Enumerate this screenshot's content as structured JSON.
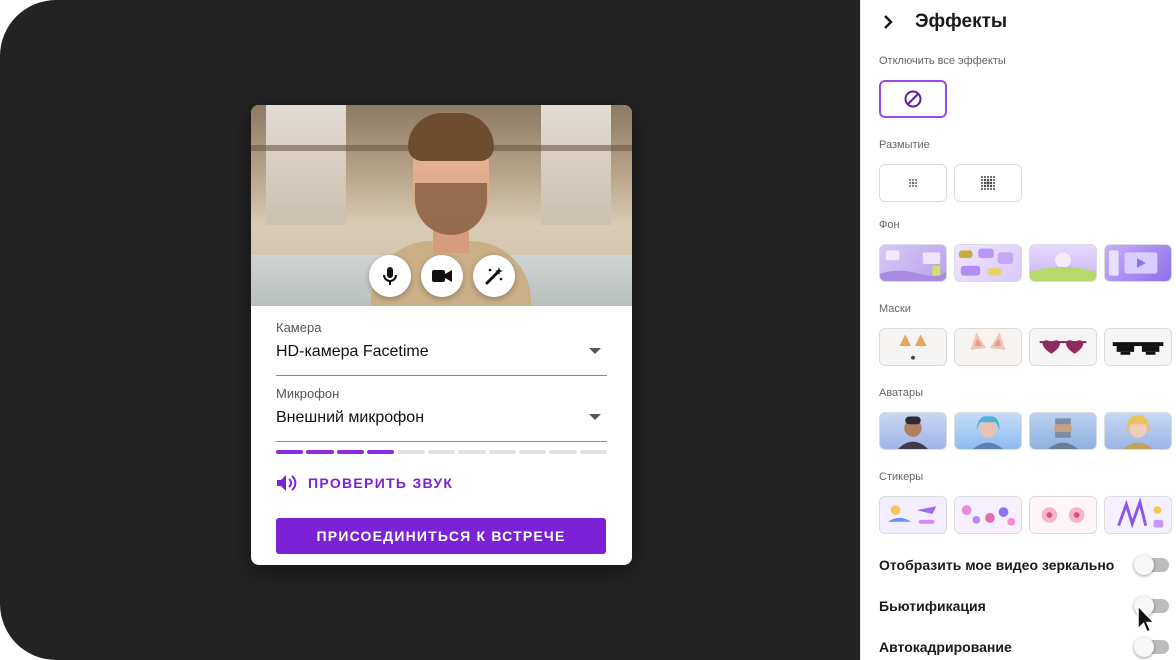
{
  "card": {
    "camera_label": "Камера",
    "camera_value": "HD-камера Facetime",
    "mic_label": "Микрофон",
    "mic_value": "Внешний микрофон",
    "mic_level_segments_total": 11,
    "mic_level_segments_active": 4,
    "check_sound": "ПРОВЕРИТЬ ЗВУК",
    "join": "ПРИСОЕДИНИТЬСЯ К ВСТРЕЧЕ",
    "controls": [
      "microphone-icon",
      "camera-icon",
      "magic-wand-icon"
    ]
  },
  "panel": {
    "title": "Эффекты",
    "disable_all": "Отключить все эффекты",
    "blur": "Размытие",
    "background": "Фон",
    "masks": "Маски",
    "avatars": "Аватары",
    "stickers": "Стикеры",
    "mirror": "Отобразить мое видео зеркально",
    "beautify": "Бьютификация",
    "autoframe": "Автокадрирование"
  },
  "colors": {
    "accent": "#7b22d6",
    "stage": "#232323"
  }
}
